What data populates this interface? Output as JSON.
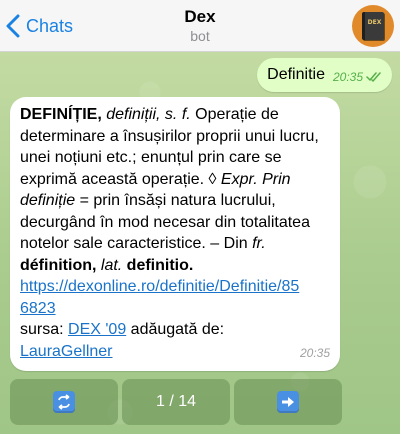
{
  "header": {
    "back_label": "Chats",
    "title": "Dex",
    "subtitle": "bot",
    "avatar_text": "DEX"
  },
  "outgoing": {
    "text": "Definitie",
    "time": "20:35"
  },
  "incoming": {
    "headword": "DEFINÍȚIE,",
    "forms": "definiții, s. f.",
    "def1": " Operație de determinare a însușirilor proprii unui lucru, unei noțiuni etc.; enunțul prin care se exprimă această operație. ◊ ",
    "expr_label": "Expr.",
    "expr_phrase": " Prin definiție",
    "def2": " = prin însăși natura lucrului, decurgând în mod necesar din totalitatea notelor sale caracteristice. – Din ",
    "fr_label": "fr.",
    "fr_word": " définition,",
    "lat_label": " lat.",
    "lat_word": " definitio.",
    "link_line1": "https://dexonline.ro/definitie/Definitie/85",
    "link_line2": "6823",
    "source_prefix": "sursa: ",
    "source_link": "DEX '09",
    "added_by": " adăugată de:",
    "author_link": "LauraGellner",
    "time": "20:35"
  },
  "keyboard": {
    "prev_icon": "repeat-icon",
    "page_label": "1 / 14",
    "next_icon": "right-arrow-icon"
  },
  "colors": {
    "accent": "#1a82e2",
    "outgoing_bubble": "#e1fec6",
    "incoming_bubble": "#ffffff",
    "link": "#1a73c9"
  }
}
